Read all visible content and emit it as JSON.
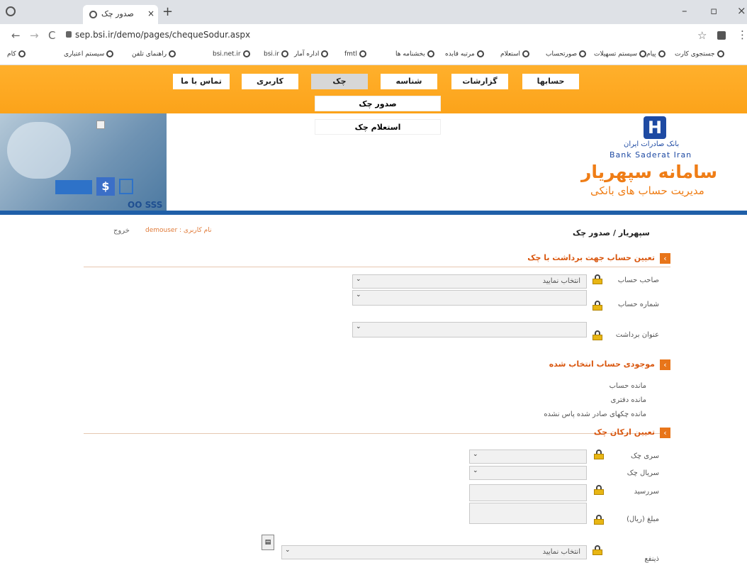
{
  "browser": {
    "tab_title": "صدور چک",
    "tab_close": "×",
    "new_tab": "+",
    "url": "sep.bsi.ir/demo/pages/chequeSodur.aspx",
    "bookmarks": [
      "جستجوی کارت",
      "پیام",
      "سیستم تسهیلات",
      "صورتحساب",
      "استعلام",
      "مرتبه قابده",
      "بخشنامه ها",
      "fmtl",
      "اداره آمار",
      "bsi.ir",
      "bsi.net.ir",
      "راهنمای تلفن",
      "سیستم اعتباری",
      "کام"
    ]
  },
  "menu": {
    "items": [
      "حسابها",
      "گزارشات",
      "شناسه",
      "چک",
      "کاربری",
      "تماس با ما"
    ],
    "dropdown": [
      "صدور چک",
      "استعلام چک"
    ]
  },
  "banner": {
    "bank_fa": "بانک صادرات ایران",
    "bank_en": "Bank Saderat Iran",
    "system_name": "سامانه سپهریار",
    "system_sub": "مدیریت حساب های بانکی",
    "sss_text": "OO SSS"
  },
  "page": {
    "breadcrumb": "سپهریار / صدور چک",
    "username_label": "نام کاربری : demouser",
    "logout": "خروج"
  },
  "section1": {
    "title": "تعیین حساب جهت برداشت با چک",
    "fields": [
      {
        "label": "صاحب حساب",
        "value": "انتخاب نمایید"
      },
      {
        "label": "شماره حساب",
        "value": ""
      },
      {
        "label": "عنوان برداشت",
        "value": ""
      }
    ]
  },
  "section2": {
    "title": "موجودی حساب انتخاب شده",
    "rows": [
      "مانده حساب",
      "مانده دفتری",
      "مانده چکهای صادر شده پاس نشده"
    ]
  },
  "section3": {
    "title": "تعیین ارکان چک",
    "fields": [
      {
        "label": "سری چک",
        "value": ""
      },
      {
        "label": "سریال چک",
        "value": ""
      },
      {
        "label": "سررسید",
        "value": ""
      },
      {
        "label": "مبلغ (ریال)",
        "value": ""
      },
      {
        "label": "ذینفع",
        "value": "انتخاب نمایید"
      }
    ]
  }
}
